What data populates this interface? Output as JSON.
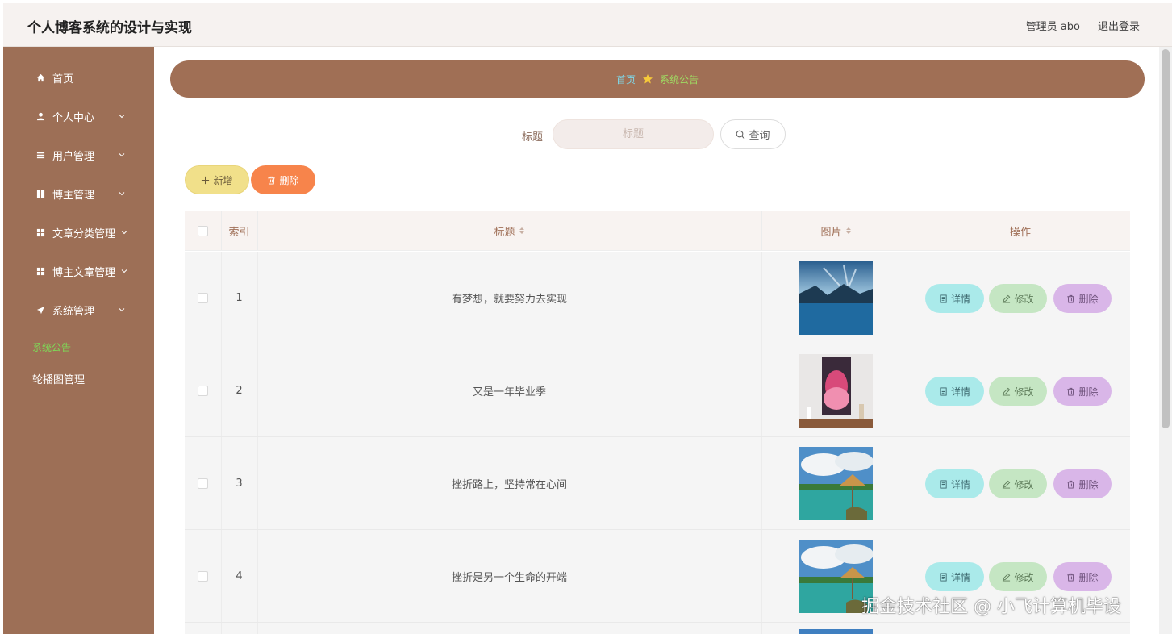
{
  "header": {
    "title": "个人博客系统的设计与实现",
    "user": "管理员 abo",
    "logout": "退出登录"
  },
  "sidebar": {
    "items": [
      {
        "label": "首页",
        "icon": "home-icon"
      },
      {
        "label": "个人中心",
        "icon": "user-icon"
      },
      {
        "label": "用户管理",
        "icon": "list-icon"
      },
      {
        "label": "博主管理",
        "icon": "grid-icon"
      },
      {
        "label": "文章分类管理",
        "icon": "grid-icon"
      },
      {
        "label": "博主文章管理",
        "icon": "grid-icon"
      },
      {
        "label": "系统管理",
        "icon": "send-icon"
      }
    ],
    "sub_items": [
      {
        "label": "系统公告",
        "active": true
      },
      {
        "label": "轮播图管理",
        "active": false
      }
    ]
  },
  "breadcrumb": {
    "home": "首页",
    "current": "系统公告"
  },
  "search": {
    "label": "标题",
    "placeholder": "标题",
    "button": "查询"
  },
  "toolbar": {
    "add": "新增",
    "delete": "删除"
  },
  "table": {
    "headers": {
      "index": "索引",
      "title": "标题",
      "image": "图片",
      "actions": "操作"
    },
    "rows": [
      {
        "index": "1",
        "title": "有梦想，就要努力去实现",
        "image": "lake"
      },
      {
        "index": "2",
        "title": "又是一年毕业季",
        "image": "painting"
      },
      {
        "index": "3",
        "title": "挫折路上，坚持常在心间",
        "image": "beach"
      },
      {
        "index": "4",
        "title": "挫折是另一个生命的开端",
        "image": "beach"
      }
    ],
    "actions": {
      "detail": "详情",
      "edit": "修改",
      "delete": "删除"
    }
  },
  "watermark": "掘金技术社区 @ 小飞计算机毕设",
  "colors": {
    "sidebar": "#9d6f56",
    "breadcrumb": "#a06f55",
    "active_sub": "#7ed957"
  }
}
